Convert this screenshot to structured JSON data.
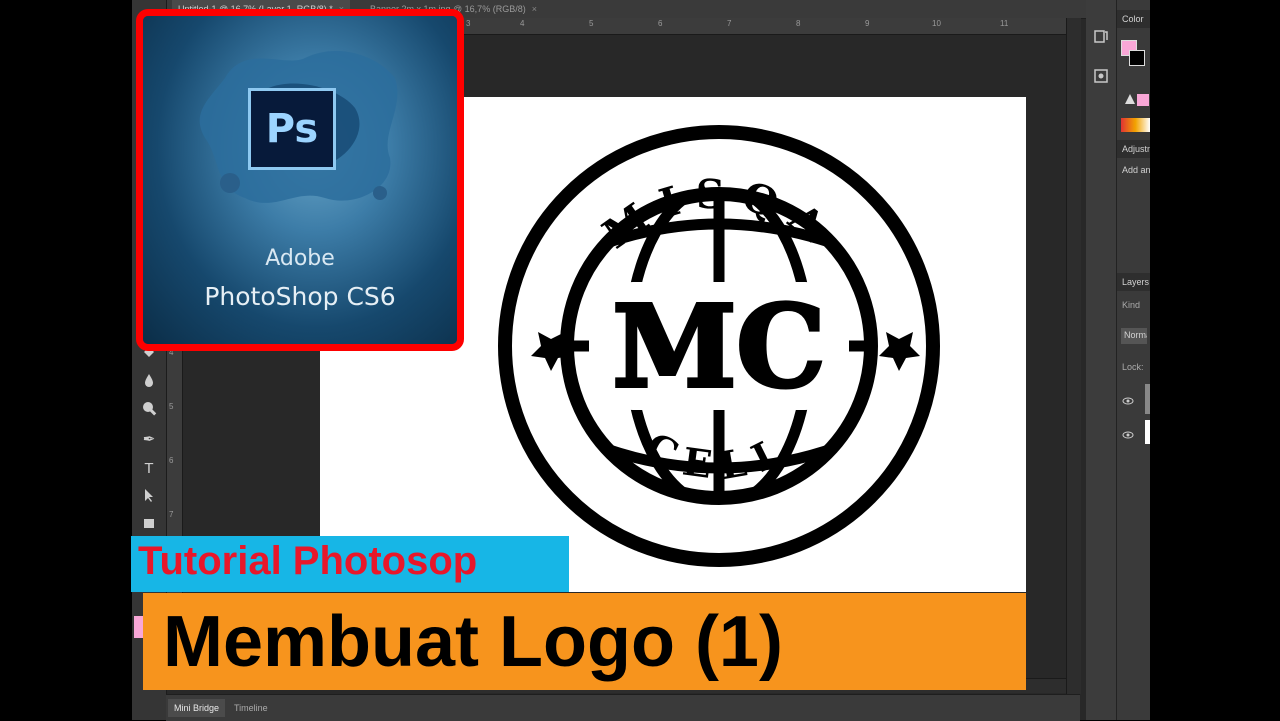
{
  "document_tabs": [
    {
      "label": "Untitled-1 @ 16,7% (Layer 1, RGB/8) *",
      "active": true
    },
    {
      "label": "Banner 2m x 1m.jpg @ 16,7% (RGB/8)",
      "active": false
    }
  ],
  "close_glyph": "×",
  "ruler_top": [
    "3",
    "4",
    "5",
    "6",
    "7",
    "8",
    "9",
    "10",
    "11"
  ],
  "ruler_left": [
    "4",
    "5",
    "6",
    "7"
  ],
  "tools": [
    "paint-bucket-icon",
    "blur-icon",
    "dodge-icon",
    "pen-icon",
    "type-icon",
    "path-selection-icon",
    "rectangle-icon"
  ],
  "tool_glyphs": {
    "type": "T",
    "pen": "✒",
    "arrow": "▲"
  },
  "right_panel": {
    "color_tab": "Color",
    "adjustments_tab": "Adjustments",
    "add_adjustment": "Add an adjustment",
    "layers_tab": "Layers",
    "kind_filter": "Kind",
    "blend_mode": "Normal",
    "lock_label": "Lock:",
    "foreground_color": "#f9a7d7",
    "background_color": "#000000"
  },
  "logo": {
    "top_text": "MISQA",
    "center_text": "MC",
    "bottom_text": "CELL"
  },
  "overlay": {
    "ps_icon_text": "Ps",
    "adobe": "Adobe",
    "product": "PhotoShop CS6",
    "tutorial_label": "Tutorial Photosop",
    "title": "Membuat Logo (1)",
    "border_color": "#fe0000",
    "tutorial_bg": "#17b6e6",
    "tutorial_color": "#e8172a",
    "title_bg": "#f7941d"
  },
  "bottom_tabs": [
    "Mini Bridge",
    "Timeline"
  ]
}
